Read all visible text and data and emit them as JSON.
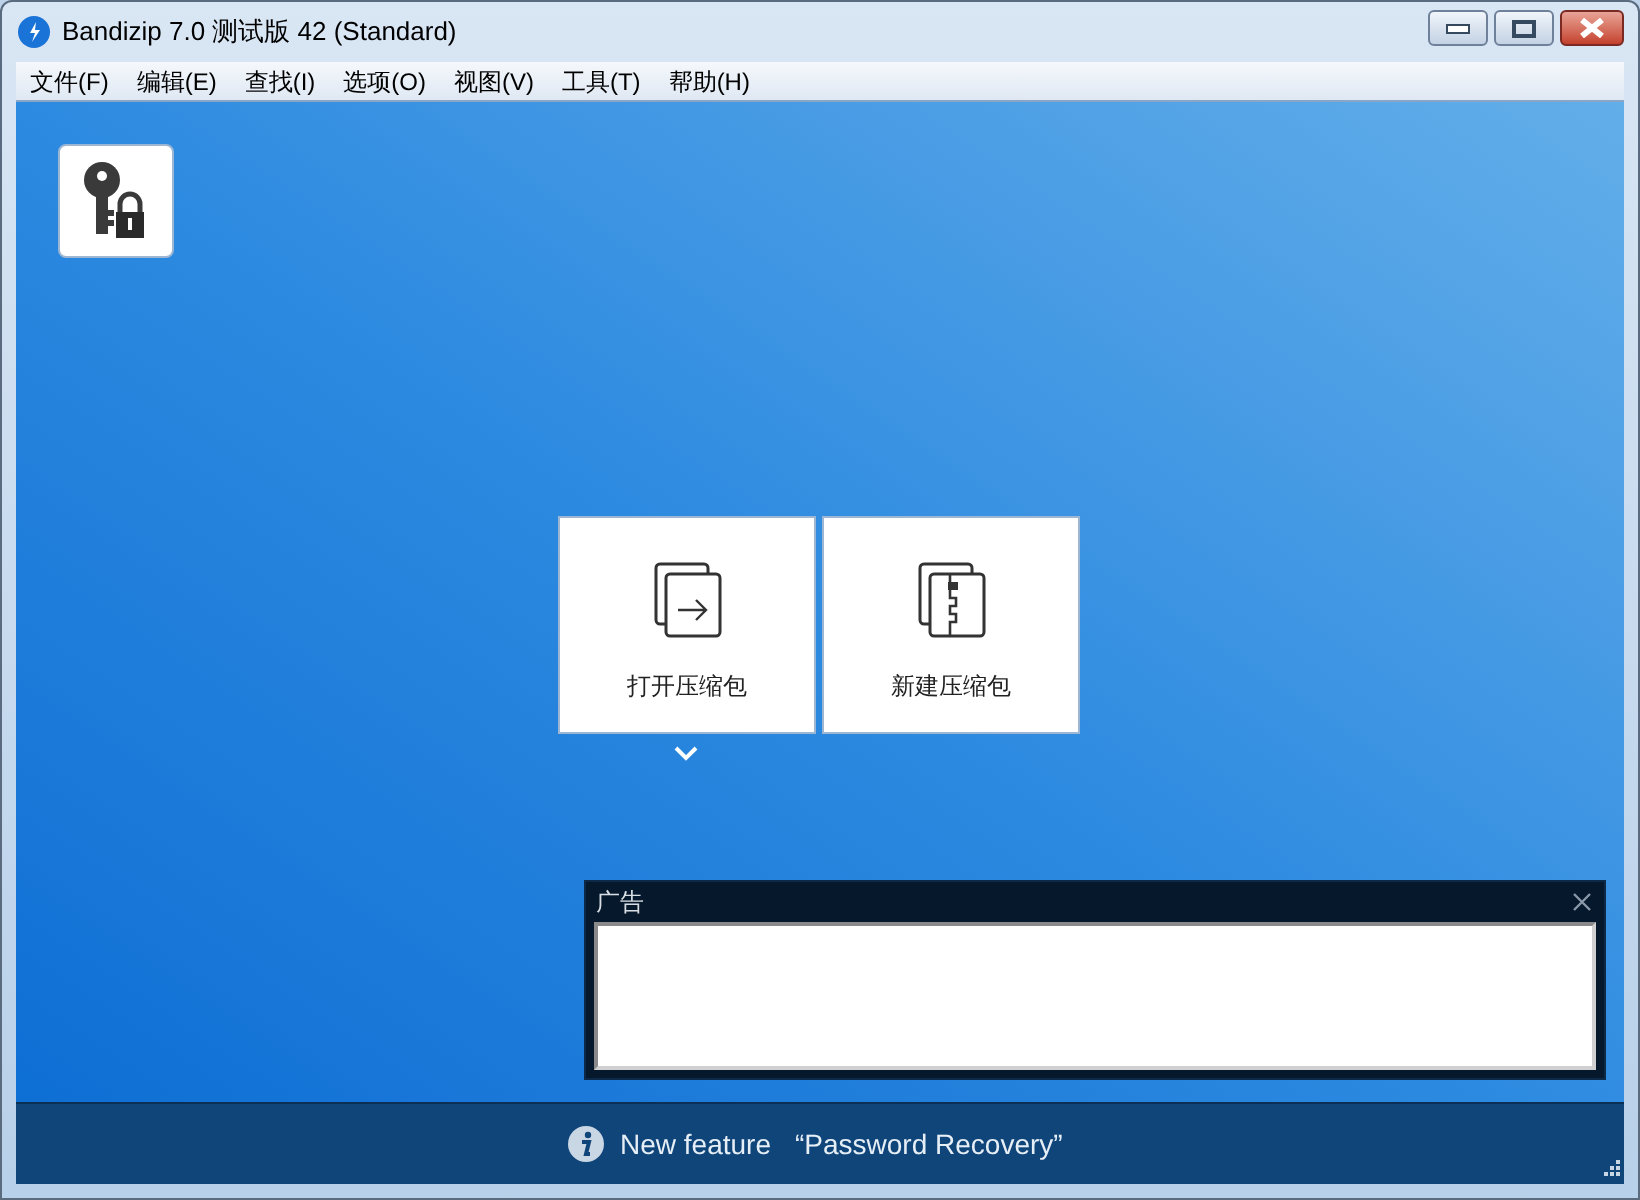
{
  "window": {
    "title": "Bandizip 7.0 测试版 42 (Standard)"
  },
  "menu": [
    "文件(F)",
    "编辑(E)",
    "查找(I)",
    "选项(O)",
    "视图(V)",
    "工具(T)",
    "帮助(H)"
  ],
  "actions": [
    {
      "kind": "open",
      "label": "打开压缩包"
    },
    {
      "kind": "new",
      "label": "新建压缩包"
    }
  ],
  "ad": {
    "title": "广告"
  },
  "status_bar": {
    "label": "New feature",
    "feature": "“Password Recovery”"
  }
}
